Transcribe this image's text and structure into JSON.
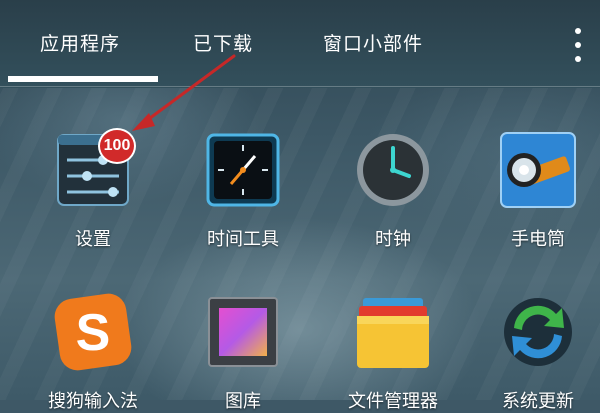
{
  "tabs": [
    {
      "label": "应用程序"
    },
    {
      "label": "已下载"
    },
    {
      "label": "窗口小部件"
    }
  ],
  "menu_icon": "overflow-menu-icon",
  "apps": [
    {
      "label": "设置",
      "icon": "settings-sliders-icon",
      "badge": "100"
    },
    {
      "label": "时间工具",
      "icon": "time-tools-icon"
    },
    {
      "label": "时钟",
      "icon": "clock-icon"
    },
    {
      "label": "手电筒",
      "icon": "flashlight-icon"
    },
    {
      "label": "搜狗输入法",
      "icon": "sogou-input-icon"
    },
    {
      "label": "图库",
      "icon": "gallery-icon"
    },
    {
      "label": "文件管理器",
      "icon": "file-manager-icon"
    },
    {
      "label": "系统更新",
      "icon": "system-update-icon"
    }
  ],
  "colors": {
    "badge": "#d12a2a",
    "arrow": "#c62828",
    "tab_indicator": "#ffffff"
  }
}
